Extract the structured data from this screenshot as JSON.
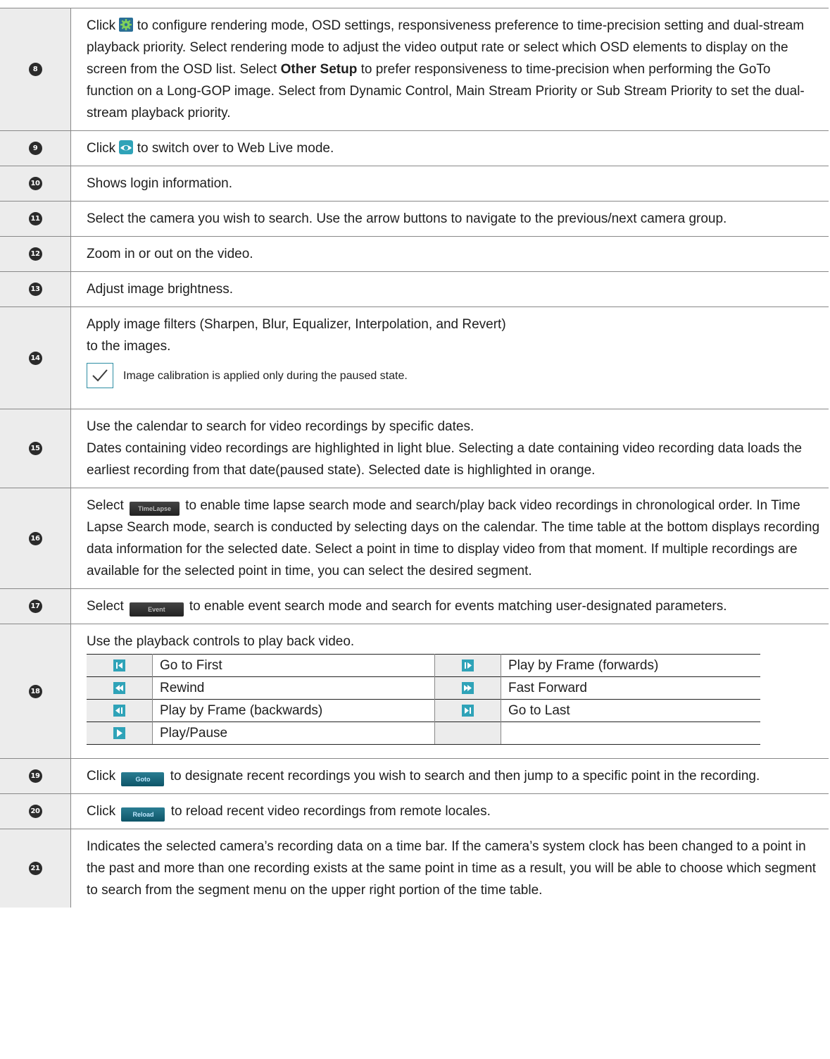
{
  "rows": [
    {
      "num": "8",
      "text_a": "Click ",
      "text_b": " to configure rendering mode, OSD settings, responsiveness preference to time-precision setting and dual-stream playback priority. Select rendering mode to adjust the video output rate or select which OSD elements to display on the screen from the OSD list. Select ",
      "bold": "Other Setup",
      "text_c": " to prefer responsiveness to time-precision when performing the GoTo function on a Long-GOP image. Select from Dynamic Control, Main Stream Priority or Sub Stream Priority to set the dual-stream playback priority."
    },
    {
      "num": "9",
      "text_a": "Click ",
      "text_b": " to switch over to Web Live mode."
    },
    {
      "num": "10",
      "text": "Shows login information."
    },
    {
      "num": "11",
      "text": "Select the camera you wish to search. Use the arrow buttons to navigate to the previous/next camera group."
    },
    {
      "num": "12",
      "text": "Zoom in or out on the video."
    },
    {
      "num": "13",
      "text": "Adjust image brightness."
    },
    {
      "num": "14",
      "line1": "Apply image filters (Sharpen, Blur, Equalizer, Interpolation, and Revert)",
      "line2": "to the images.",
      "note": "Image calibration is applied only during the paused state."
    },
    {
      "num": "15",
      "line1": "Use the calendar to search for video recordings by specific dates.",
      "line2": "Dates containing video recordings are highlighted in light blue. Selecting a date containing video recording data loads the earliest recording from that date(paused state). Selected date is highlighted in orange."
    },
    {
      "num": "16",
      "text_a": "Select ",
      "button": "TimeLapse",
      "text_b": " to enable time lapse search mode and search/play back video recordings in chronological order. In Time Lapse Search mode, search is conducted by selecting days on the calendar. The time table at the bottom displays recording data information for the selected date. Select a point in time to display video from that moment. If multiple recordings are available for the selected point in time, you can select the desired segment."
    },
    {
      "num": "17",
      "text_a": "Select ",
      "button": "Event",
      "text_b": " to enable event search mode and search for events matching user-designated parameters."
    },
    {
      "num": "18",
      "intro": "Use the playback controls to play back video.",
      "controls": [
        {
          "left": "Go to First",
          "right": "Play by Frame (forwards)"
        },
        {
          "left": "Rewind",
          "right": "Fast Forward"
        },
        {
          "left": "Play by Frame (backwards)",
          "right": "Go to Last"
        },
        {
          "left": "Play/Pause",
          "right": ""
        }
      ]
    },
    {
      "num": "19",
      "text_a": "Click ",
      "button": "Goto",
      "text_b": " to designate recent recordings you wish to search and then jump to a specific point in the recording."
    },
    {
      "num": "20",
      "text_a": "Click ",
      "button": "Reload",
      "text_b": " to reload recent video recordings from remote locales."
    },
    {
      "num": "21",
      "text": "Indicates the selected camera’s recording data on a time bar. If the camera’s system clock has been changed to a point in the past and more than one recording exists at the same point in time as a result, you will be able to choose which segment to search from the segment menu on the upper right portion of the time table."
    }
  ],
  "colors": {
    "accent": "#2fa3b8",
    "number_bg": "#ececec",
    "badge": "#2b2b2b"
  }
}
